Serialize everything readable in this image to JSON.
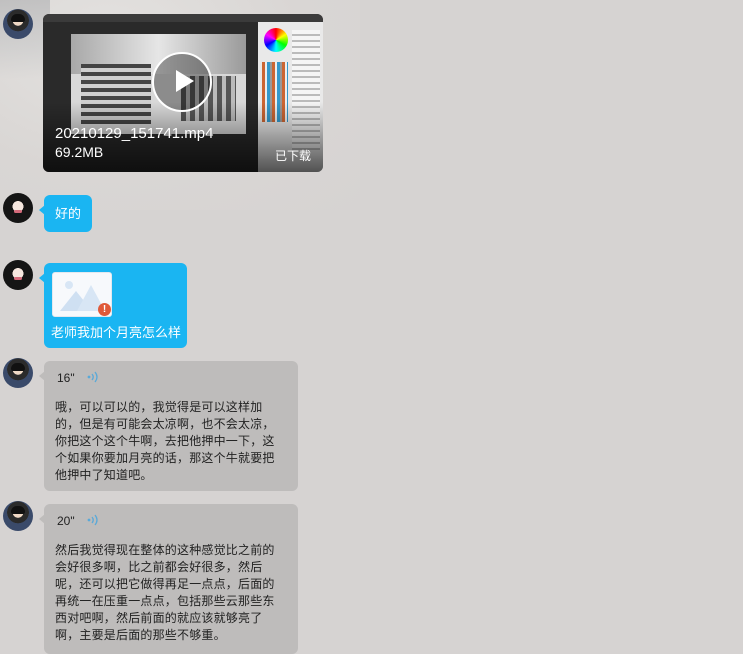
{
  "video": {
    "filename": "20210129_151741.mp4",
    "size": "69.2MB",
    "status": "已下载"
  },
  "messages": {
    "text1": "好的",
    "image_caption": "老师我加个月亮怎么样",
    "image_error_mark": "!",
    "voice1": {
      "duration": "16\"",
      "transcript": "哦，可以可以的，我觉得是可以这样加的，但是有可能会太凉啊，也不会太凉，你把这个这个牛啊，去把他押中一下，这个如果你要加月亮的话，那这个牛就要把他押中了知道吧。"
    },
    "voice2": {
      "duration": "20\"",
      "transcript": "然后我觉得现在整体的这种感觉比之前的会好很多啊，比之前都会好很多，然后呢，还可以把它做得再足一点点，后面的再统一在压重一点点，包括那些云那些东西对吧啊，然后前面的就应该就够亮了啊，主要是后面的那些不够重。"
    }
  },
  "colors": {
    "accent_bubble": "#1ab5f2",
    "voice_bubble": "#bebcbb",
    "background": "#d6d3d2"
  },
  "icons": [
    "play-icon",
    "voice-wave-icon",
    "image-placeholder-icon",
    "error-icon"
  ]
}
